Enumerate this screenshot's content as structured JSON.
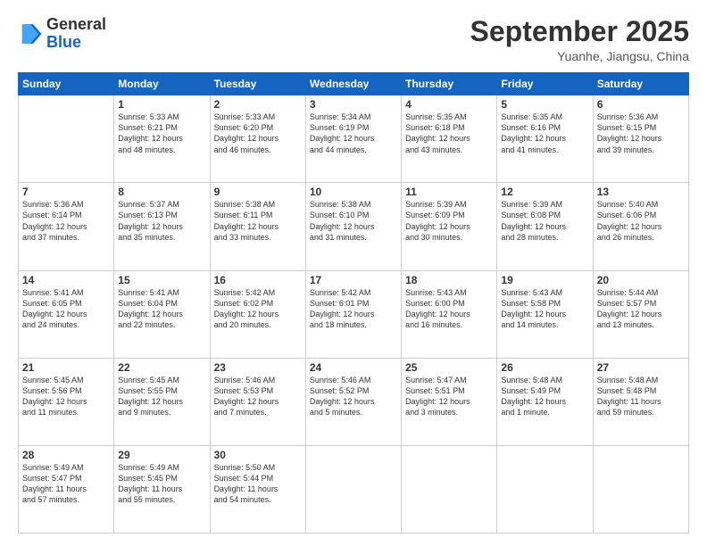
{
  "header": {
    "logo_general": "General",
    "logo_blue": "Blue",
    "month": "September 2025",
    "location": "Yuanhe, Jiangsu, China"
  },
  "days_of_week": [
    "Sunday",
    "Monday",
    "Tuesday",
    "Wednesday",
    "Thursday",
    "Friday",
    "Saturday"
  ],
  "weeks": [
    [
      {
        "day": "",
        "info": ""
      },
      {
        "day": "1",
        "info": "Sunrise: 5:33 AM\nSunset: 6:21 PM\nDaylight: 12 hours\nand 48 minutes."
      },
      {
        "day": "2",
        "info": "Sunrise: 5:33 AM\nSunset: 6:20 PM\nDaylight: 12 hours\nand 46 minutes."
      },
      {
        "day": "3",
        "info": "Sunrise: 5:34 AM\nSunset: 6:19 PM\nDaylight: 12 hours\nand 44 minutes."
      },
      {
        "day": "4",
        "info": "Sunrise: 5:35 AM\nSunset: 6:18 PM\nDaylight: 12 hours\nand 43 minutes."
      },
      {
        "day": "5",
        "info": "Sunrise: 5:35 AM\nSunset: 6:16 PM\nDaylight: 12 hours\nand 41 minutes."
      },
      {
        "day": "6",
        "info": "Sunrise: 5:36 AM\nSunset: 6:15 PM\nDaylight: 12 hours\nand 39 minutes."
      }
    ],
    [
      {
        "day": "7",
        "info": "Sunrise: 5:36 AM\nSunset: 6:14 PM\nDaylight: 12 hours\nand 37 minutes."
      },
      {
        "day": "8",
        "info": "Sunrise: 5:37 AM\nSunset: 6:13 PM\nDaylight: 12 hours\nand 35 minutes."
      },
      {
        "day": "9",
        "info": "Sunrise: 5:38 AM\nSunset: 6:11 PM\nDaylight: 12 hours\nand 33 minutes."
      },
      {
        "day": "10",
        "info": "Sunrise: 5:38 AM\nSunset: 6:10 PM\nDaylight: 12 hours\nand 31 minutes."
      },
      {
        "day": "11",
        "info": "Sunrise: 5:39 AM\nSunset: 6:09 PM\nDaylight: 12 hours\nand 30 minutes."
      },
      {
        "day": "12",
        "info": "Sunrise: 5:39 AM\nSunset: 6:08 PM\nDaylight: 12 hours\nand 28 minutes."
      },
      {
        "day": "13",
        "info": "Sunrise: 5:40 AM\nSunset: 6:06 PM\nDaylight: 12 hours\nand 26 minutes."
      }
    ],
    [
      {
        "day": "14",
        "info": "Sunrise: 5:41 AM\nSunset: 6:05 PM\nDaylight: 12 hours\nand 24 minutes."
      },
      {
        "day": "15",
        "info": "Sunrise: 5:41 AM\nSunset: 6:04 PM\nDaylight: 12 hours\nand 22 minutes."
      },
      {
        "day": "16",
        "info": "Sunrise: 5:42 AM\nSunset: 6:02 PM\nDaylight: 12 hours\nand 20 minutes."
      },
      {
        "day": "17",
        "info": "Sunrise: 5:42 AM\nSunset: 6:01 PM\nDaylight: 12 hours\nand 18 minutes."
      },
      {
        "day": "18",
        "info": "Sunrise: 5:43 AM\nSunset: 6:00 PM\nDaylight: 12 hours\nand 16 minutes."
      },
      {
        "day": "19",
        "info": "Sunrise: 5:43 AM\nSunset: 5:58 PM\nDaylight: 12 hours\nand 14 minutes."
      },
      {
        "day": "20",
        "info": "Sunrise: 5:44 AM\nSunset: 5:57 PM\nDaylight: 12 hours\nand 13 minutes."
      }
    ],
    [
      {
        "day": "21",
        "info": "Sunrise: 5:45 AM\nSunset: 5:56 PM\nDaylight: 12 hours\nand 11 minutes."
      },
      {
        "day": "22",
        "info": "Sunrise: 5:45 AM\nSunset: 5:55 PM\nDaylight: 12 hours\nand 9 minutes."
      },
      {
        "day": "23",
        "info": "Sunrise: 5:46 AM\nSunset: 5:53 PM\nDaylight: 12 hours\nand 7 minutes."
      },
      {
        "day": "24",
        "info": "Sunrise: 5:46 AM\nSunset: 5:52 PM\nDaylight: 12 hours\nand 5 minutes."
      },
      {
        "day": "25",
        "info": "Sunrise: 5:47 AM\nSunset: 5:51 PM\nDaylight: 12 hours\nand 3 minutes."
      },
      {
        "day": "26",
        "info": "Sunrise: 5:48 AM\nSunset: 5:49 PM\nDaylight: 12 hours\nand 1 minute."
      },
      {
        "day": "27",
        "info": "Sunrise: 5:48 AM\nSunset: 5:48 PM\nDaylight: 11 hours\nand 59 minutes."
      }
    ],
    [
      {
        "day": "28",
        "info": "Sunrise: 5:49 AM\nSunset: 5:47 PM\nDaylight: 11 hours\nand 57 minutes."
      },
      {
        "day": "29",
        "info": "Sunrise: 5:49 AM\nSunset: 5:45 PM\nDaylight: 11 hours\nand 55 minutes."
      },
      {
        "day": "30",
        "info": "Sunrise: 5:50 AM\nSunset: 5:44 PM\nDaylight: 11 hours\nand 54 minutes."
      },
      {
        "day": "",
        "info": ""
      },
      {
        "day": "",
        "info": ""
      },
      {
        "day": "",
        "info": ""
      },
      {
        "day": "",
        "info": ""
      }
    ]
  ]
}
